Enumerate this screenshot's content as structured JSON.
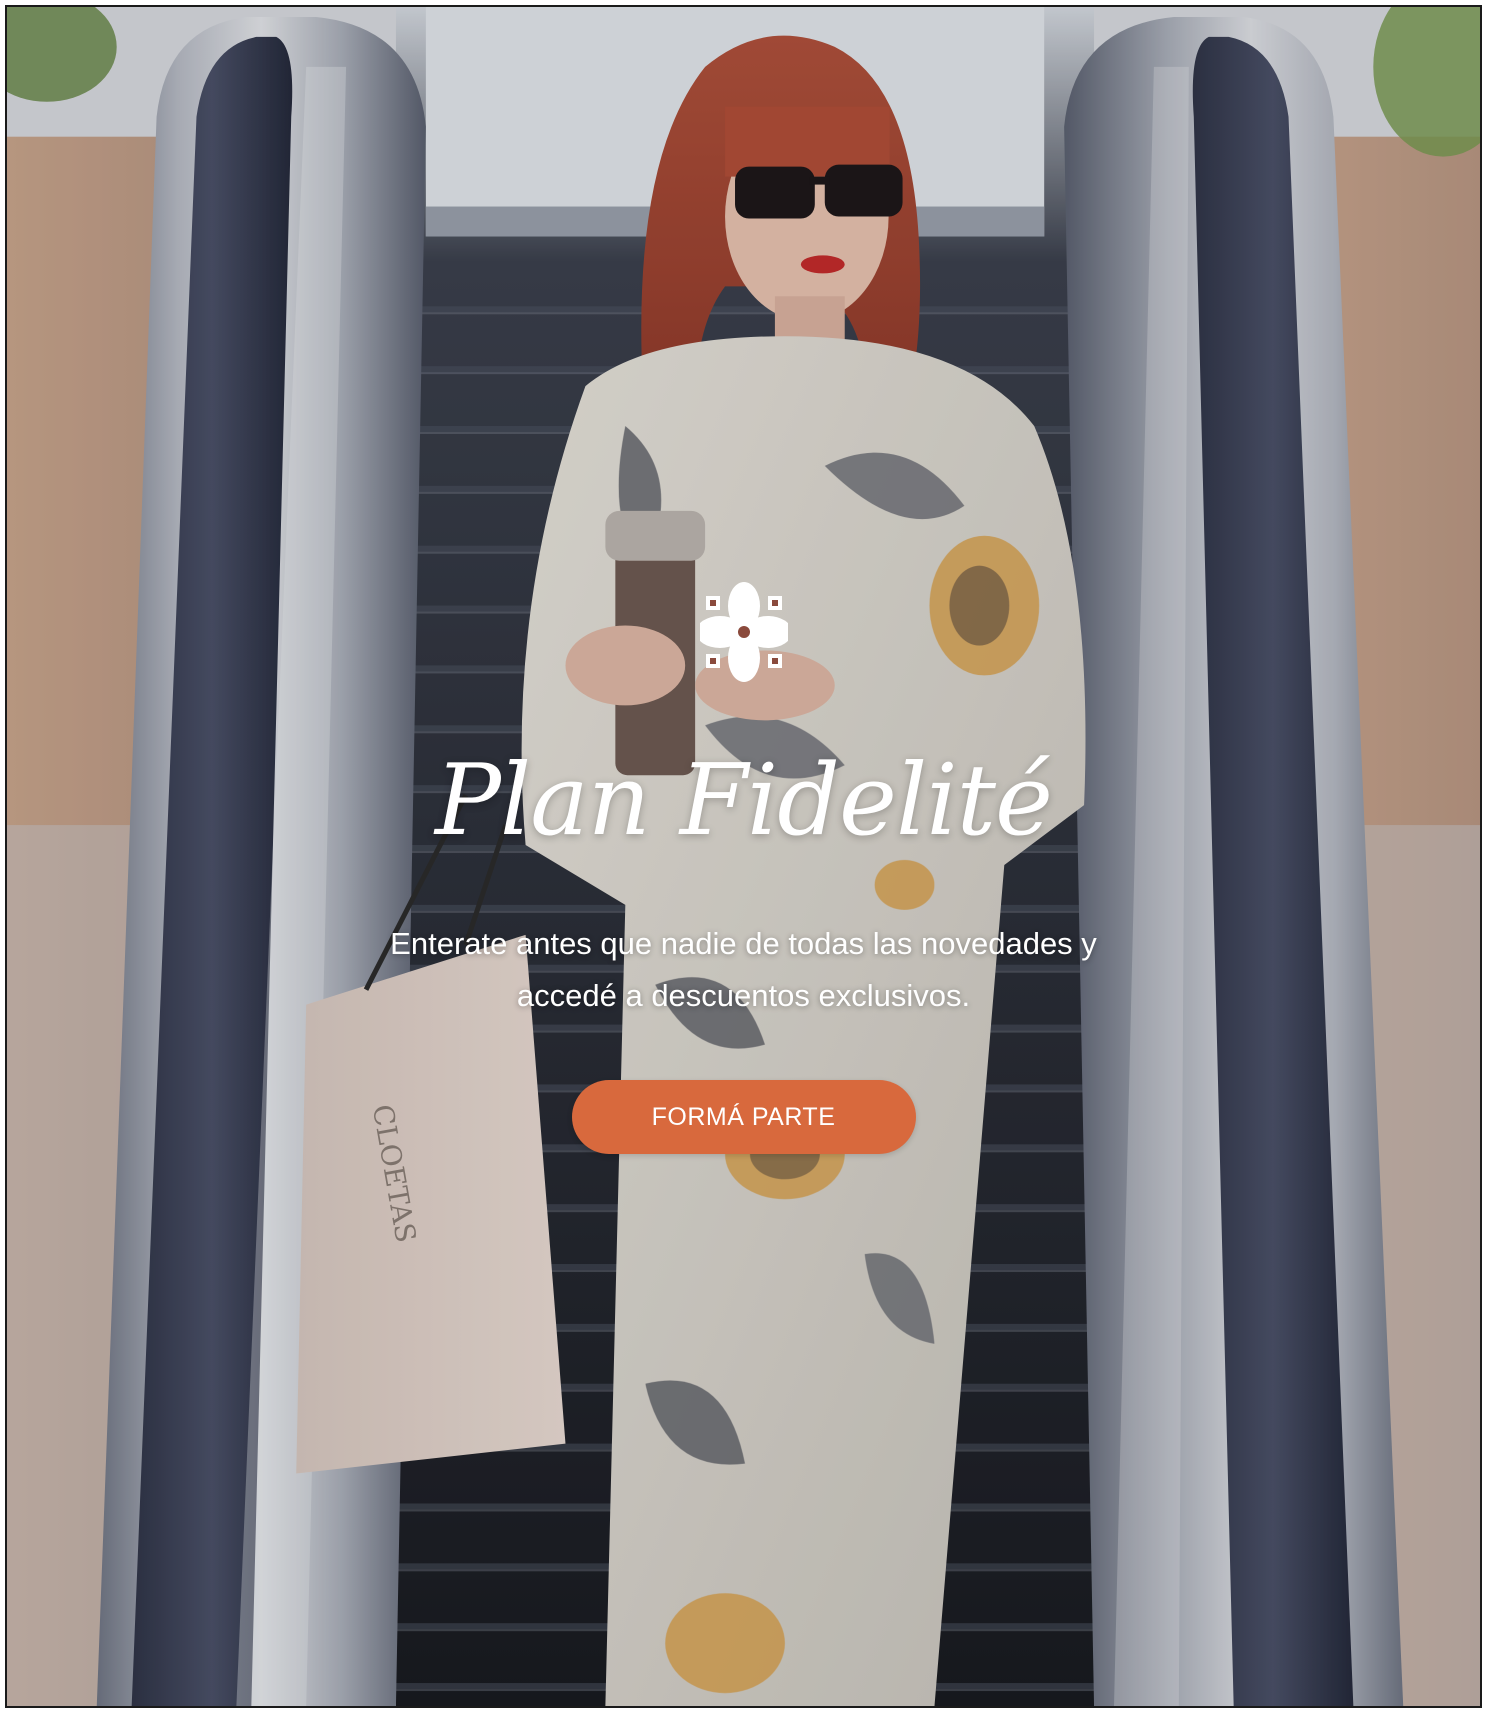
{
  "hero": {
    "logo_icon": "floral-quatrefoil-icon",
    "title": "Plan Fidelité",
    "subtitle": "Enterate antes que nadie de todas las novedades y accedé a descuentos exclusivos.",
    "cta_label": "FORMÁ PARTE"
  },
  "colors": {
    "cta_background": "#d8693d",
    "text": "#ffffff"
  }
}
